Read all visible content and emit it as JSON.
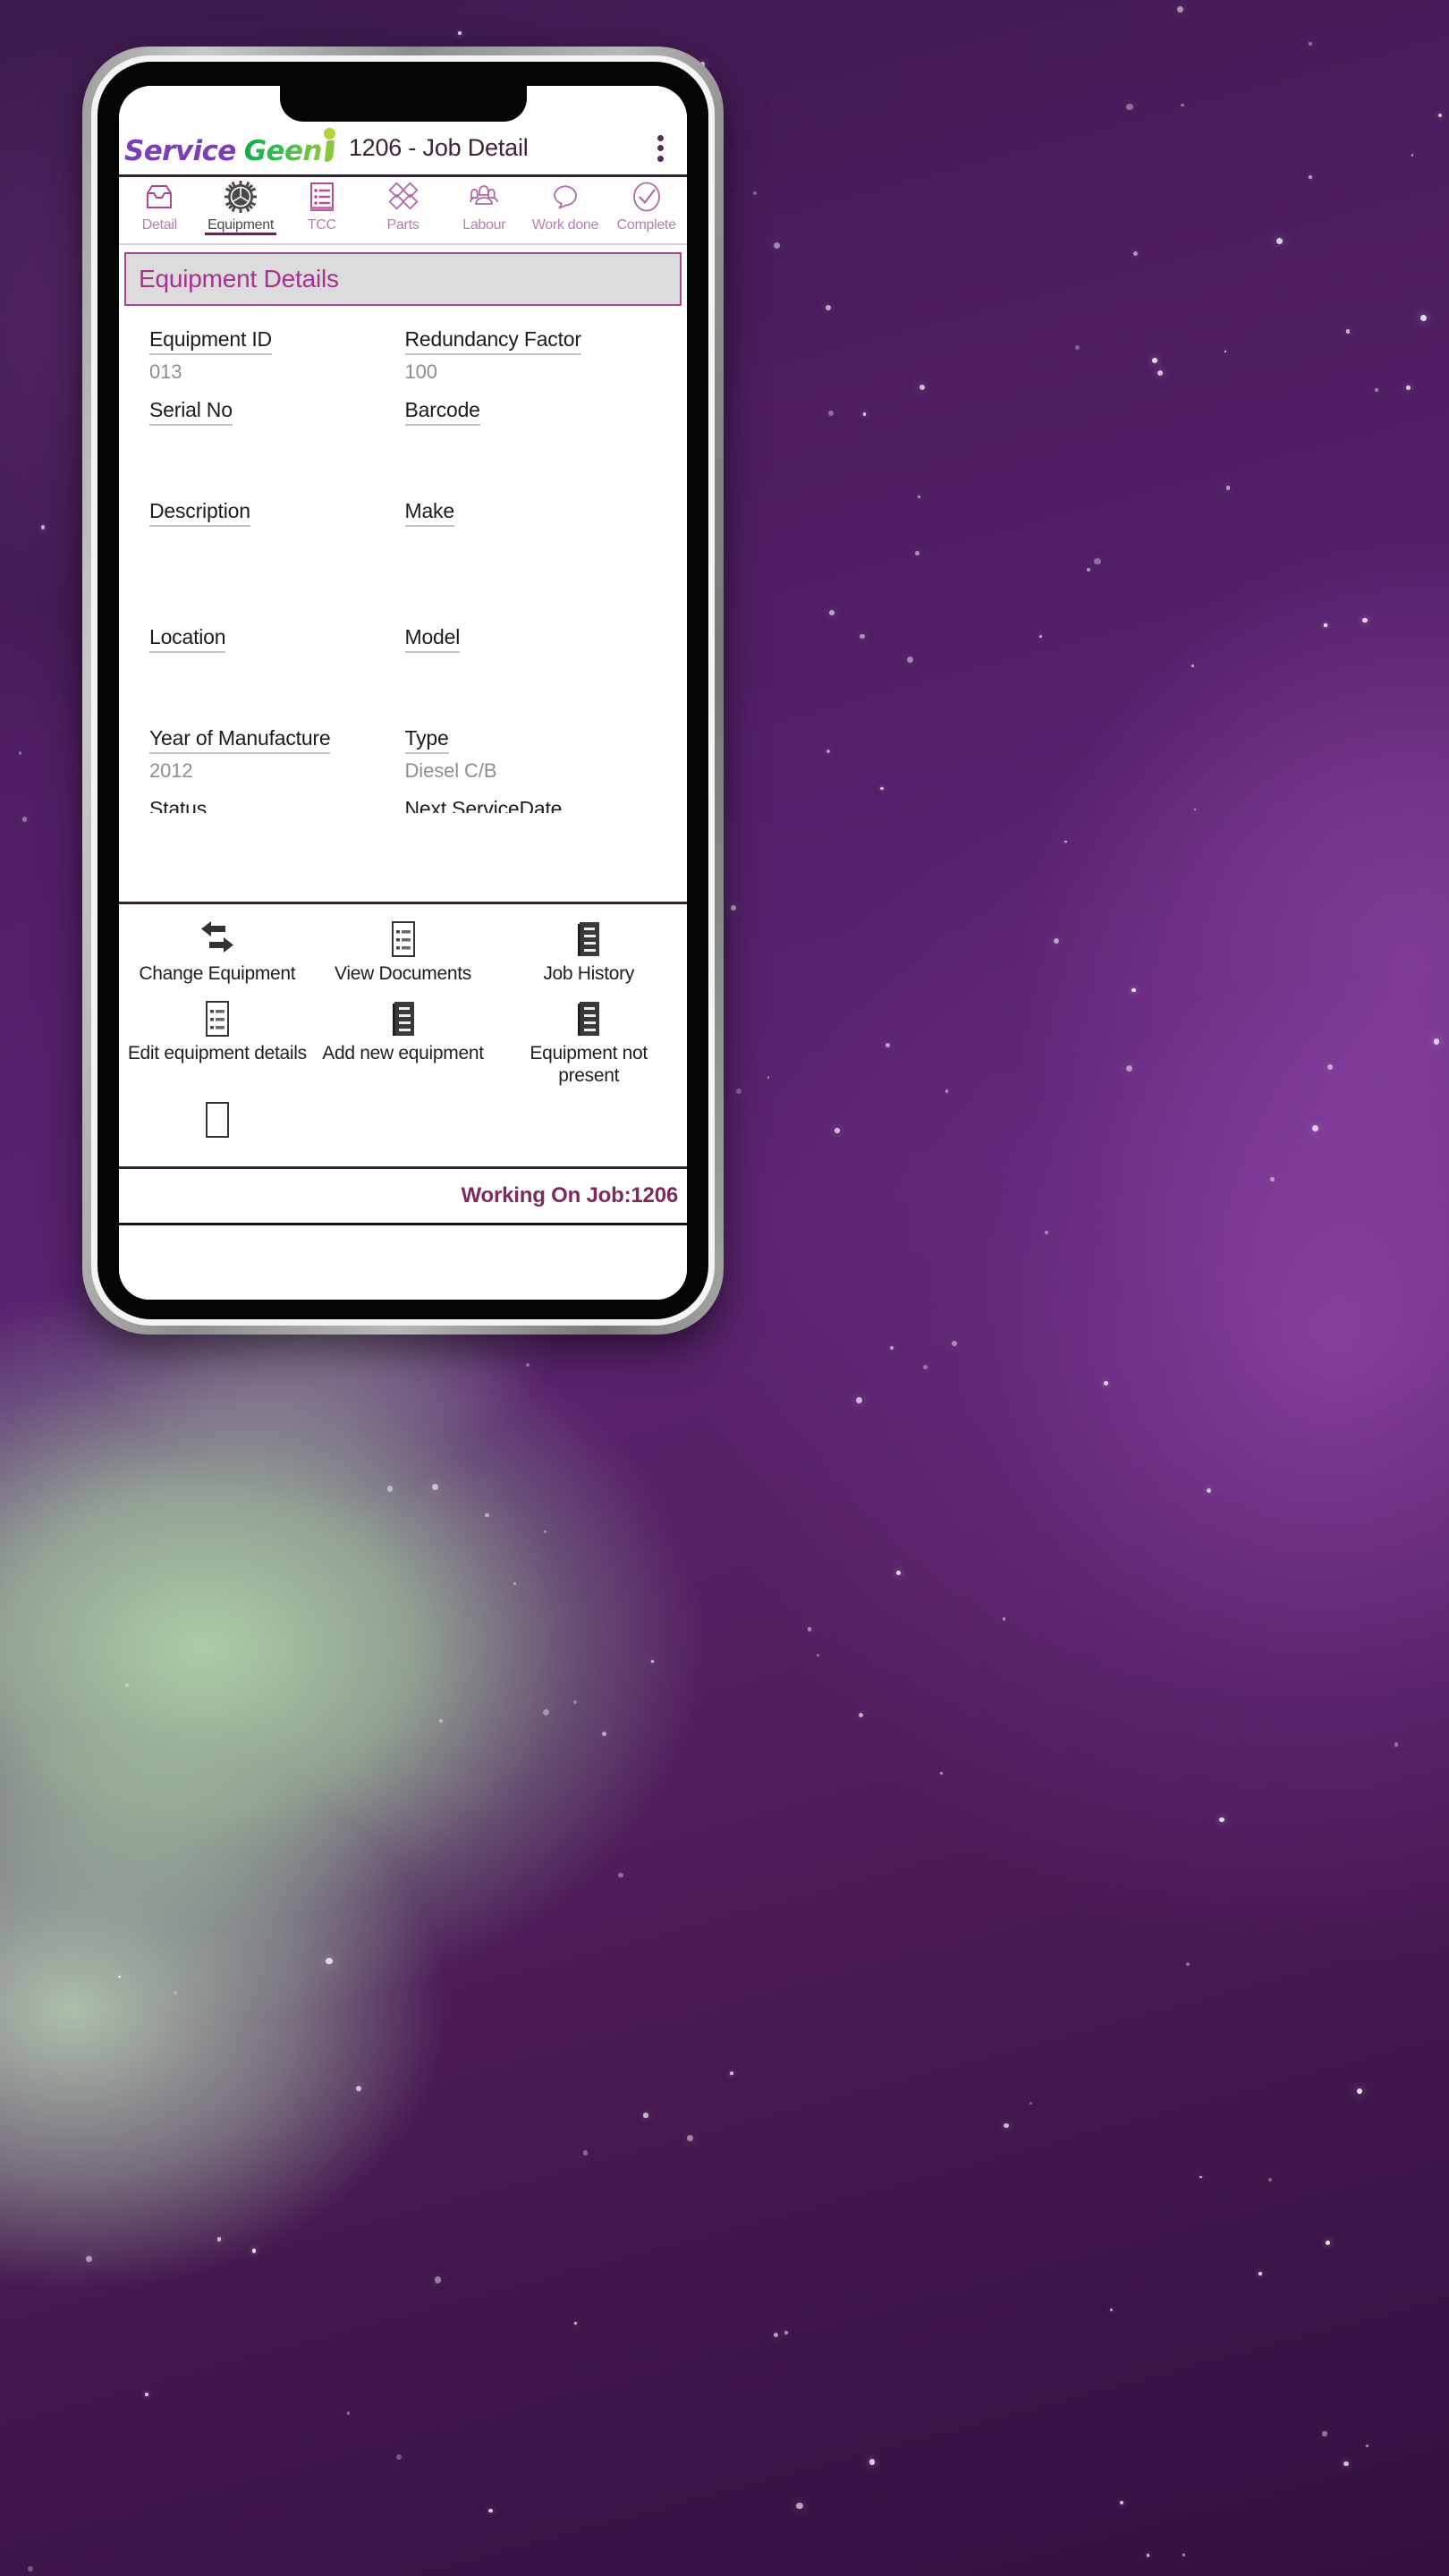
{
  "header": {
    "logo_service": "Service",
    "logo_geen": "Geen",
    "logo_i": "i",
    "job_title": "1206 - Job Detail",
    "overflow_icon": "three-dots-vertical-icon"
  },
  "tabs": [
    {
      "label": "Detail",
      "icon": "inbox-tray-icon",
      "active": false
    },
    {
      "label": "Equipment",
      "icon": "gear-icon",
      "active": true
    },
    {
      "label": "TCC",
      "icon": "checklist-icon",
      "active": false
    },
    {
      "label": "Parts",
      "icon": "diamonds-icon",
      "active": false
    },
    {
      "label": "Labour",
      "icon": "people-icon",
      "active": false
    },
    {
      "label": "Work done",
      "icon": "speech-bubble-icon",
      "active": false
    },
    {
      "label": "Complete",
      "icon": "check-circle-icon",
      "active": false
    }
  ],
  "section": {
    "title": "Equipment Details"
  },
  "form": {
    "rows": [
      [
        {
          "label": "Equipment ID",
          "value": "013"
        },
        {
          "label": "Redundancy Factor",
          "value": "100"
        }
      ],
      [
        {
          "label": "Serial No",
          "value": ""
        },
        {
          "label": "Barcode",
          "value": ""
        }
      ],
      [
        {
          "label": "Description",
          "value": ""
        },
        {
          "label": "Make",
          "value": ""
        }
      ],
      [
        {
          "label": "Location",
          "value": ""
        },
        {
          "label": "Model",
          "value": ""
        }
      ],
      [
        {
          "label": "Year of Manufacture",
          "value": "2012"
        },
        {
          "label": "Type",
          "value": "Diesel C/B"
        }
      ],
      [
        {
          "label": "Status",
          "value": ""
        },
        {
          "label": "Next ServiceDate",
          "value": ""
        }
      ]
    ]
  },
  "actions": [
    [
      {
        "label": "Change Equipment",
        "icon": "swap-arrows-icon"
      },
      {
        "label": "View Documents",
        "icon": "document-list-outline-icon"
      },
      {
        "label": "Job History",
        "icon": "document-list-filled-icon"
      }
    ],
    [
      {
        "label": "Edit equipment details",
        "icon": "document-list-outline-icon"
      },
      {
        "label": "Add new equipment",
        "icon": "document-list-filled-icon"
      },
      {
        "label": "Equipment not present",
        "icon": "document-list-filled-icon"
      }
    ],
    [
      {
        "label": "",
        "icon": "document-list-outline-icon"
      },
      {
        "label": "",
        "icon": ""
      },
      {
        "label": "",
        "icon": ""
      }
    ]
  ],
  "footer": {
    "status": "Working On Job:1206"
  },
  "colors": {
    "brand_purple": "#7a3fb5",
    "brand_green": "#2eb358",
    "accent_magenta": "#a8328f",
    "tab_inactive": "#b582b0",
    "footer_text": "#7e2a5e"
  }
}
